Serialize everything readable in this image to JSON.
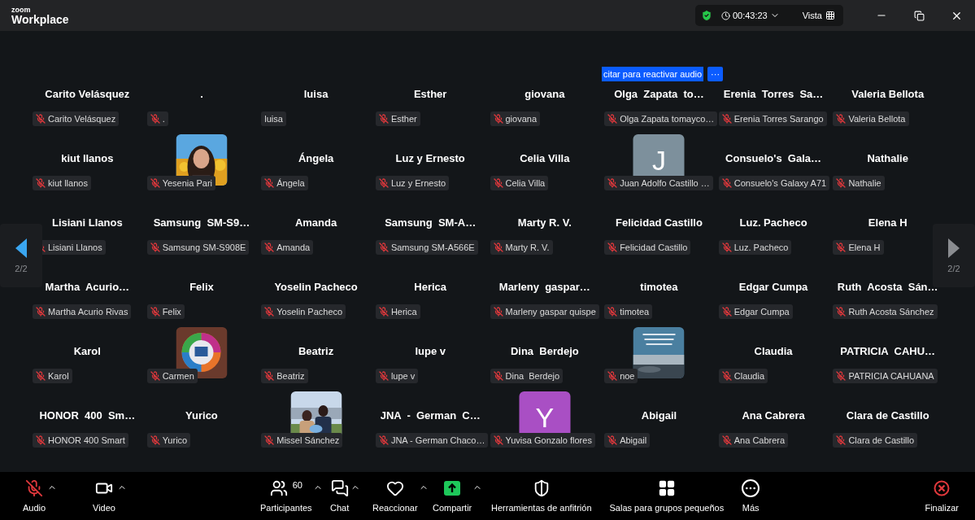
{
  "app": {
    "brand_top": "zoom",
    "brand": "Workplace"
  },
  "meeting": {
    "secure": true,
    "timer": "00:43:23",
    "view": "Vista"
  },
  "banner": {
    "text": "citar para reactivar audio",
    "more": "···"
  },
  "tiles": [
    {
      "kind": "name",
      "name": "Carito Velásquez",
      "label": "Carito Velásquez",
      "muted": true
    },
    {
      "kind": "name",
      "name": ".",
      "label": ".",
      "muted": true
    },
    {
      "kind": "name",
      "name": "luisa",
      "label": "luisa",
      "muted": false
    },
    {
      "kind": "name",
      "name": "Esther",
      "label": "Esther",
      "muted": true
    },
    {
      "kind": "name",
      "name": "giovana",
      "label": "giovana",
      "muted": true
    },
    {
      "kind": "name",
      "name": "Olga  Zapata  to…",
      "label": "Olga Zapata tomayco…",
      "muted": true
    },
    {
      "kind": "name",
      "name": "Erenia  Torres  Sa…",
      "label": "Erenia Torres Sarango",
      "muted": true
    },
    {
      "kind": "name",
      "name": "Valeria Bellota",
      "label": "Valeria Bellota",
      "muted": true
    },
    {
      "kind": "name",
      "name": "kiut llanos",
      "label": "kiut llanos",
      "muted": true
    },
    {
      "kind": "picture",
      "label": "Yesenia Pari",
      "muted": true
    },
    {
      "kind": "name",
      "name": "Ángela",
      "label": "Ángela",
      "muted": true
    },
    {
      "kind": "name",
      "name": "Luz y Ernesto",
      "label": "Luz y Ernesto",
      "muted": true
    },
    {
      "kind": "name",
      "name": "Celia Villa",
      "label": "Celia Villa",
      "muted": true
    },
    {
      "kind": "initial",
      "initial": "J",
      "color": "#7d909c",
      "label": "Juan Adolfo Castillo …",
      "muted": true
    },
    {
      "kind": "name",
      "name": "Consuelo's  Gala…",
      "label": "Consuelo's Galaxy A71",
      "muted": true
    },
    {
      "kind": "name",
      "name": "Nathalie",
      "label": "Nathalie",
      "muted": true
    },
    {
      "kind": "name",
      "name": "Lisiani Llanos",
      "label": "Lisiani Llanos",
      "muted": true
    },
    {
      "kind": "name",
      "name": "Samsung  SM-S9…",
      "label": "Samsung SM-S908E",
      "muted": true
    },
    {
      "kind": "name",
      "name": "Amanda",
      "label": "Amanda",
      "muted": true
    },
    {
      "kind": "name",
      "name": "Samsung  SM-A…",
      "label": "Samsung SM-A566E",
      "muted": true
    },
    {
      "kind": "name",
      "name": "Marty R. V.",
      "label": "Marty R. V.",
      "muted": true
    },
    {
      "kind": "name",
      "name": "Felicidad Castillo",
      "label": "Felicidad Castillo",
      "muted": true
    },
    {
      "kind": "name",
      "name": "Luz. Pacheco",
      "label": "Luz. Pacheco",
      "muted": true
    },
    {
      "kind": "name",
      "name": "Elena H",
      "label": "Elena H",
      "muted": true
    },
    {
      "kind": "name",
      "name": "Martha  Acurio…",
      "label": "Martha Acurio Rivas",
      "muted": true
    },
    {
      "kind": "name",
      "name": "Felix",
      "label": "Felix",
      "muted": true
    },
    {
      "kind": "name",
      "name": "Yoselin Pacheco",
      "label": "Yoselin Pacheco",
      "muted": true
    },
    {
      "kind": "name",
      "name": "Herica",
      "label": "Herica",
      "muted": true
    },
    {
      "kind": "name",
      "name": "Marleny  gaspar…",
      "label": "Marleny gaspar quispe",
      "muted": true
    },
    {
      "kind": "name",
      "name": "timotea",
      "label": "timotea",
      "muted": true
    },
    {
      "kind": "name",
      "name": "Edgar Cumpa",
      "label": "Edgar Cumpa",
      "muted": true
    },
    {
      "kind": "name",
      "name": "Ruth  Acosta  Sán…",
      "label": "Ruth Acosta Sánchez",
      "muted": true
    },
    {
      "kind": "name",
      "name": "Karol",
      "label": "Karol",
      "muted": true
    },
    {
      "kind": "picture",
      "label": "Carmen",
      "muted": true
    },
    {
      "kind": "name",
      "name": "Beatriz",
      "label": "Beatriz",
      "muted": true
    },
    {
      "kind": "name",
      "name": "lupe v",
      "label": "lupe v",
      "muted": true
    },
    {
      "kind": "name",
      "name": "Dina  Berdejo",
      "label": "Dina  Berdejo",
      "muted": true
    },
    {
      "kind": "picture",
      "label": "noe",
      "muted": true
    },
    {
      "kind": "name",
      "name": "Claudia",
      "label": "Claudia",
      "muted": true
    },
    {
      "kind": "name",
      "name": "PATRICIA  CAHU…",
      "label": "PATRICIA CAHUANA",
      "muted": true
    },
    {
      "kind": "name",
      "name": "HONOR  400  Sm…",
      "label": "HONOR 400 Smart",
      "muted": true
    },
    {
      "kind": "name",
      "name": "Yurico",
      "label": "Yurico",
      "muted": true
    },
    {
      "kind": "picture",
      "label": "Missel Sánchez",
      "muted": true
    },
    {
      "kind": "name",
      "name": "JNA  -  German  C…",
      "label": "JNA - German Chaco…",
      "muted": true
    },
    {
      "kind": "initial",
      "initial": "Y",
      "color": "#a94fc4",
      "label": "Yuvisa Gonzalo flores",
      "muted": true
    },
    {
      "kind": "name",
      "name": "Abigail",
      "label": "Abigail",
      "muted": true
    },
    {
      "kind": "name",
      "name": "Ana Cabrera",
      "label": "Ana Cabrera",
      "muted": true
    },
    {
      "kind": "name",
      "name": "Clara de Castillo",
      "label": "Clara de Castillo",
      "muted": true
    }
  ],
  "pager": [
    {
      "kind": "prev",
      "page": "2/2",
      "enabled": true
    },
    {
      "kind": "next",
      "page": "2/2",
      "enabled": false
    }
  ],
  "toolbar": [
    {
      "kind": "audio",
      "label": "Audio",
      "muted": true,
      "caret": true
    },
    {
      "kind": "video",
      "label": "Video",
      "caret": true
    },
    {
      "kind": "participants",
      "label": "Participantes",
      "count": "60",
      "caret": true
    },
    {
      "kind": "chat",
      "label": "Chat",
      "caret": true
    },
    {
      "kind": "react",
      "label": "Reaccionar",
      "caret": true
    },
    {
      "kind": "share",
      "label": "Compartir",
      "caret": true
    },
    {
      "kind": "host",
      "label": "Herramientas de anfitrión",
      "caret": false
    },
    {
      "kind": "rooms",
      "label": "Salas para grupos pequeños",
      "caret": false
    },
    {
      "kind": "more",
      "label": "Más",
      "caret": false
    },
    {
      "kind": "end",
      "label": "Finalizar",
      "caret": false
    }
  ]
}
